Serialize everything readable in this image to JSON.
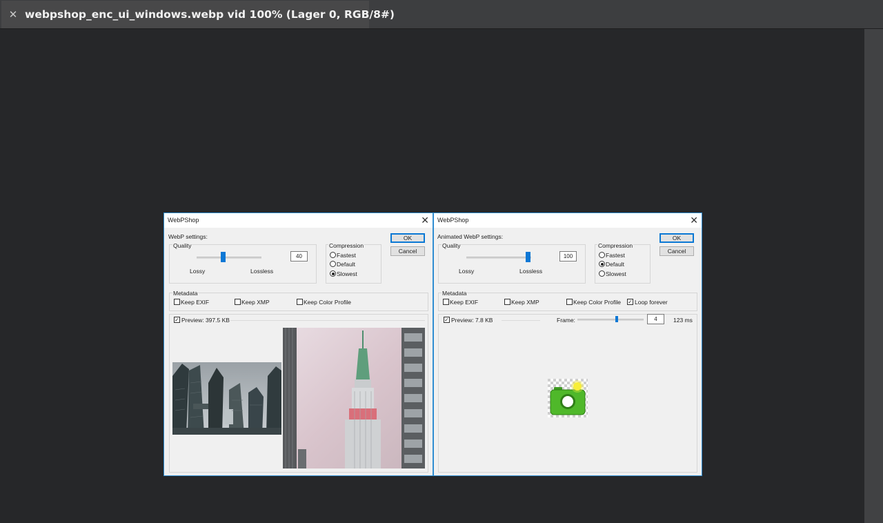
{
  "tab": {
    "title": "webpshop_enc_ui_windows.webp vid 100% (Lager 0, RGB/8#)",
    "close_glyph": "✕"
  },
  "dialog_left": {
    "title": "WebPShop",
    "close_glyph": "✕",
    "settings_label": "WebP settings:",
    "quality": {
      "label": "Quality",
      "value": "40",
      "level": 0.4,
      "left_label": "Lossy",
      "right_label": "Lossless"
    },
    "compression": {
      "label": "Compression",
      "options": [
        "Fastest",
        "Default",
        "Slowest"
      ],
      "selected": "Slowest"
    },
    "ok_label": "OK",
    "cancel_label": "Cancel",
    "metadata": {
      "label": "Metadata",
      "keep_exif": "Keep EXIF",
      "keep_xmp": "Keep XMP",
      "keep_color_profile": "Keep Color Profile"
    },
    "preview_label": "Preview: 397.5 KB",
    "preview_checked": true
  },
  "dialog_right": {
    "title": "WebPShop",
    "close_glyph": "✕",
    "settings_label": "Animated WebP settings:",
    "quality": {
      "label": "Quality",
      "value": "100",
      "level": 1.0,
      "left_label": "Lossy",
      "right_label": "Lossless"
    },
    "compression": {
      "label": "Compression",
      "options": [
        "Fastest",
        "Default",
        "Slowest"
      ],
      "selected": "Default"
    },
    "ok_label": "OK",
    "cancel_label": "Cancel",
    "metadata": {
      "label": "Metadata",
      "keep_exif": "Keep EXIF",
      "keep_xmp": "Keep XMP",
      "keep_color_profile": "Keep Color Profile",
      "loop_forever": "Loop forever",
      "loop_checked": true
    },
    "preview_label": "Preview: 7.8 KB",
    "preview_checked": true,
    "frame_label": "Frame:",
    "frame_value": "4",
    "frame_time": "123 ms"
  },
  "colors": {
    "accent": "#0e78d5",
    "dialog_border": "#2f8dd2",
    "app_bg": "#262729",
    "camera_green": "#4fb82a"
  }
}
